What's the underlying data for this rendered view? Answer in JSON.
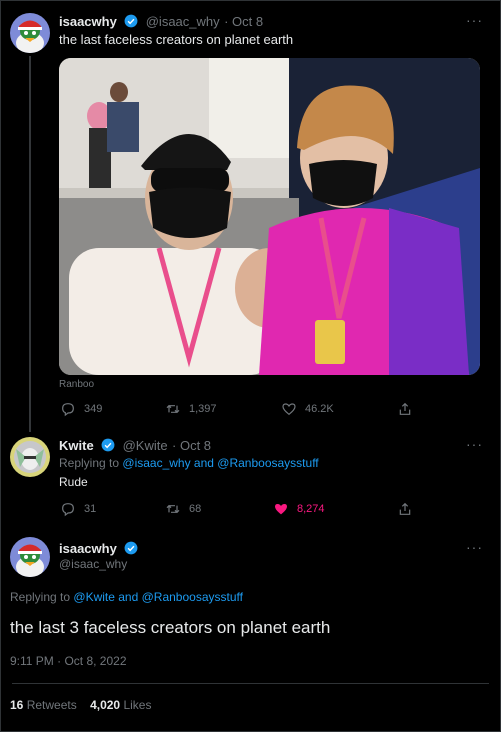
{
  "tweet1": {
    "display_name": "isaacwhy",
    "handle": "@isaac_why",
    "date": "· Oct 8",
    "text": "the last faceless creators on planet earth",
    "photo_tag": "Ranboo",
    "replies": "349",
    "retweets": "1,397",
    "likes": "46.2K"
  },
  "tweet2": {
    "display_name": "Kwite",
    "handle": "@Kwite",
    "date": "· Oct 8",
    "replying_prefix": "Replying to",
    "replying_users": "@isaac_why and @Ranboosaysstuff",
    "text": "Rude",
    "replies": "31",
    "retweets": "68",
    "likes": "8,274"
  },
  "tweet3": {
    "display_name": "isaacwhy",
    "handle": "@isaac_why",
    "replying_prefix": "Replying to",
    "replying_users": "@Kwite and @Ranboosaysstuff",
    "text": "the last 3 faceless creators on planet earth",
    "timestamp": "9:11 PM · Oct 8, 2022",
    "retweets_count": "16",
    "retweets_label": "Retweets",
    "likes_count": "4,020",
    "likes_label": "Likes"
  },
  "colors": {
    "background": "#000000",
    "accent": "#1d9bf0",
    "liked": "#f91880",
    "muted": "#71767b"
  },
  "icons": [
    "verified-badge-icon",
    "more-icon",
    "reply-icon",
    "retweet-icon",
    "like-icon",
    "share-icon"
  ]
}
